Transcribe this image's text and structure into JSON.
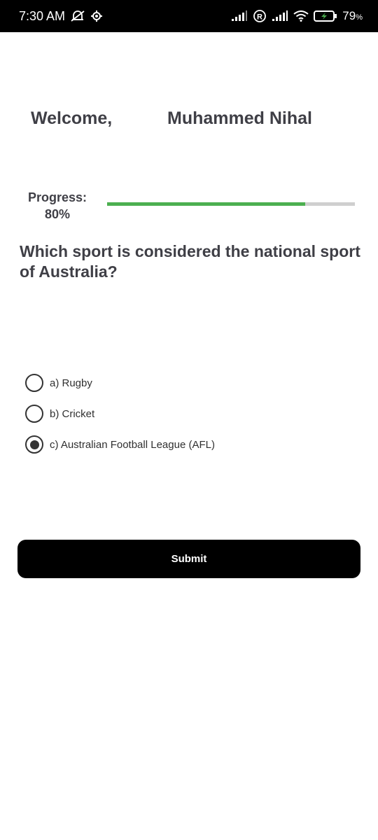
{
  "status_bar": {
    "time": "7:30 AM",
    "icons": [
      "silent-alarm-icon",
      "settings-gear-icon",
      "signal-icon",
      "roaming-icon",
      "signal-icon",
      "wifi-icon",
      "battery-charging-icon"
    ],
    "battery_percent": "79",
    "battery_unit": "%"
  },
  "welcome": {
    "greeting": "Welcome,",
    "name": "Muhammed Nihal"
  },
  "progress": {
    "label": "Progress:",
    "value_text": "80%",
    "value": 0.8,
    "fill_color": "#4caf50",
    "track_color": "#cfcfcf"
  },
  "question": {
    "text": "Which sport is considered the national sport of Australia?"
  },
  "options": [
    {
      "label": "a) Rugby",
      "selected": false
    },
    {
      "label": "b) Cricket",
      "selected": false
    },
    {
      "label": "c) Australian Football League (AFL)",
      "selected": true
    }
  ],
  "submit": {
    "label": "Submit"
  }
}
